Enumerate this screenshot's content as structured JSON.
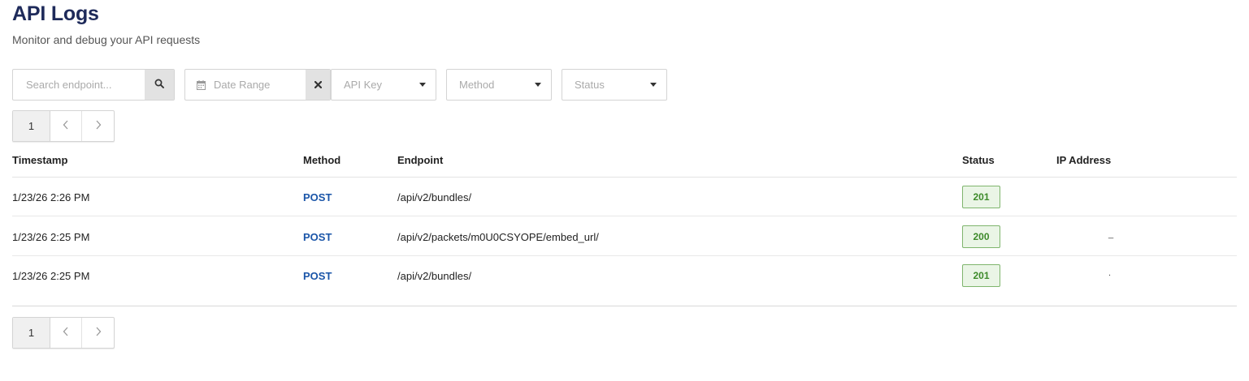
{
  "header": {
    "title": "API Logs",
    "subtitle": "Monitor and debug your API requests"
  },
  "filters": {
    "search_placeholder": "Search endpoint...",
    "search_icon": "search-icon",
    "date_range_label": "Date Range",
    "date_icon": "calendar-icon",
    "clear_icon": "close-icon",
    "api_key_label": "API Key",
    "method_label": "Method",
    "status_label": "Status"
  },
  "pagination": {
    "top": {
      "current_page": "1"
    },
    "bottom": {
      "current_page": "1"
    }
  },
  "table": {
    "headers": {
      "timestamp": "Timestamp",
      "method": "Method",
      "endpoint": "Endpoint",
      "status": "Status",
      "ip": "IP Address"
    },
    "rows": [
      {
        "timestamp": "1/23/26 2:26 PM",
        "method": "POST",
        "endpoint": "/api/v2/bundles/",
        "status": "201",
        "ip": ""
      },
      {
        "timestamp": "1/23/26 2:25 PM",
        "method": "POST",
        "endpoint": "/api/v2/packets/m0U0CSYOPE/embed_url/",
        "status": "200",
        "ip": "_"
      },
      {
        "timestamp": "1/23/26 2:25 PM",
        "method": "POST",
        "endpoint": "/api/v2/bundles/",
        "status": "201",
        "ip": "."
      }
    ]
  },
  "colors": {
    "title": "#1e2a5a",
    "method": "#1a55a8",
    "status_success_text": "#3d8a2a",
    "status_success_bg": "#eaf5e6",
    "status_success_border": "#7fb56d"
  }
}
